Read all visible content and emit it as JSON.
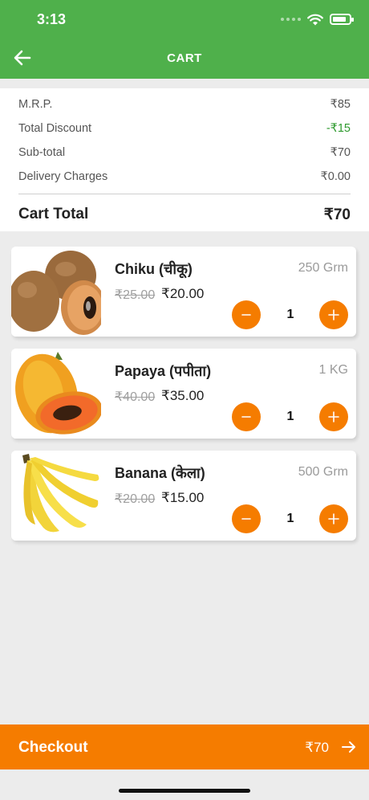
{
  "status_bar": {
    "time": "3:13"
  },
  "header": {
    "title": "CART",
    "back_icon": "arrow-left-icon"
  },
  "summary": {
    "rows": [
      {
        "label": "M.R.P.",
        "value": "₹85"
      },
      {
        "label": "Total Discount",
        "value": "-₹15"
      },
      {
        "label": "Sub-total",
        "value": "₹70"
      },
      {
        "label": "Delivery Charges",
        "value": "₹0.00"
      }
    ],
    "total_label": "Cart Total",
    "total_value": "₹70",
    "discount_color": "#2e9a2e"
  },
  "items": [
    {
      "name": "Chiku (चीकू)",
      "weight": "250 Grm",
      "mrp": "₹25.00",
      "price": "₹20.00",
      "qty": "1"
    },
    {
      "name": "Papaya (पपीता)",
      "weight": "1 KG",
      "mrp": "₹40.00",
      "price": "₹35.00",
      "qty": "1"
    },
    {
      "name": "Banana (केला)",
      "weight": "500 Grm",
      "mrp": "₹20.00",
      "price": "₹15.00",
      "qty": "1"
    }
  ],
  "checkout": {
    "label": "Checkout",
    "amount": "₹70"
  },
  "colors": {
    "header": "#4fb04b",
    "accent": "#f57c00"
  }
}
